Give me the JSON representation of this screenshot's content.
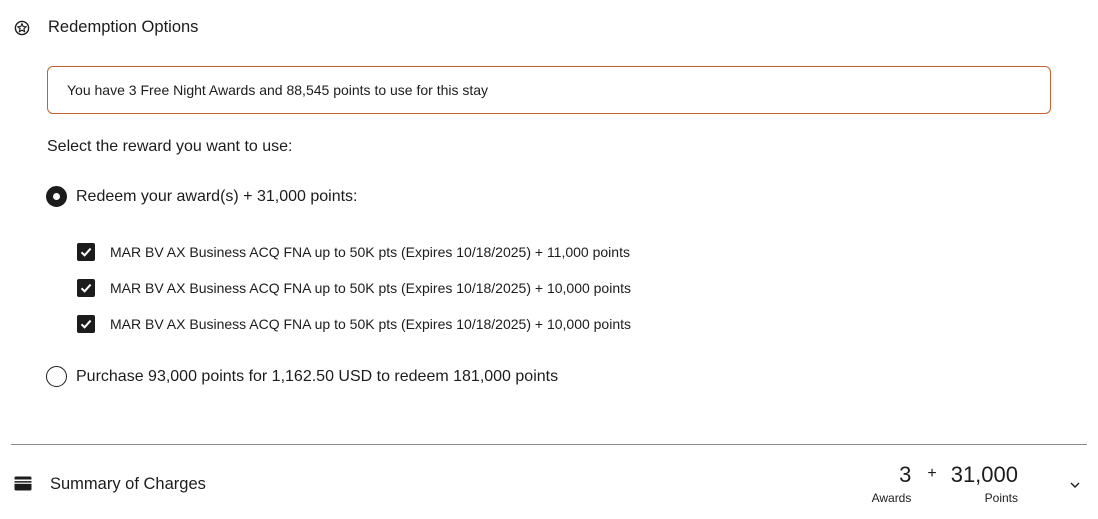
{
  "redemption": {
    "title": "Redemption Options",
    "icon": "reward-badge-icon",
    "info_message": "You have 3 Free Night Awards and 88,545 points to use for this stay",
    "prompt": "Select the reward you want to use:",
    "options": [
      {
        "label": "Redeem your award(s) + 31,000 points:",
        "selected": true,
        "awards": [
          {
            "label": "MAR BV AX Business ACQ FNA up to 50K pts (Expires 10/18/2025) + 11,000 points",
            "checked": true
          },
          {
            "label": "MAR BV AX Business ACQ FNA up to 50K pts (Expires 10/18/2025) + 10,000 points",
            "checked": true
          },
          {
            "label": "MAR BV AX Business ACQ FNA up to 50K pts (Expires 10/18/2025) + 10,000 points",
            "checked": true
          }
        ]
      },
      {
        "label": "Purchase 93,000 points for 1,162.50 USD to redeem 181,000 points",
        "selected": false
      }
    ]
  },
  "summary": {
    "title": "Summary of Charges",
    "icon": "wallet-icon",
    "awards_value": "3",
    "awards_caption": "Awards",
    "plus": "+",
    "points_value": "31,000",
    "points_caption": "Points",
    "expand_icon": "chevron-down-icon"
  },
  "colors": {
    "banner_border": "#c4622d",
    "text": "#1c1c1c",
    "divider": "#8a8a8a"
  }
}
